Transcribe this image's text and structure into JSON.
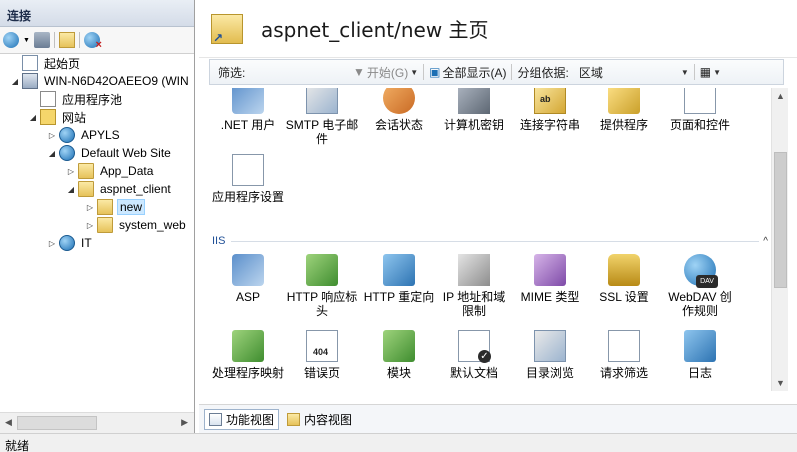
{
  "connections": {
    "title": "连接",
    "tree": [
      {
        "label": "起始页",
        "icon": "start-page-icon",
        "level": 1,
        "expander": ""
      },
      {
        "label": "WIN-N6D42OAEEO9 (WIN",
        "icon": "server-icon",
        "level": 1,
        "expander": "◢"
      },
      {
        "label": "应用程序池",
        "icon": "app-pool-icon",
        "level": 2,
        "expander": ""
      },
      {
        "label": "网站",
        "icon": "sites-icon",
        "level": 2,
        "expander": "◢"
      },
      {
        "label": "APYLS",
        "icon": "globe-icon",
        "level": 3,
        "expander": "▷"
      },
      {
        "label": "Default Web Site",
        "icon": "globe-icon",
        "level": 3,
        "expander": "◢"
      },
      {
        "label": "App_Data",
        "icon": "folder-icon",
        "level": 4,
        "expander": "▷"
      },
      {
        "label": "aspnet_client",
        "icon": "folder-icon",
        "level": 4,
        "expander": "◢"
      },
      {
        "label": "new",
        "icon": "application-icon",
        "level": 5,
        "expander": "▷",
        "selected": true
      },
      {
        "label": "system_web",
        "icon": "folder-icon",
        "level": 5,
        "expander": "▷"
      },
      {
        "label": "IT",
        "icon": "globe-icon",
        "level": 3,
        "expander": "▷"
      }
    ]
  },
  "header": {
    "title": "aspnet_client/new 主页"
  },
  "filterbar": {
    "filter_label": "筛选:",
    "start_label": "开始(G)",
    "show_all_label": "全部显示(A)",
    "groupby_label": "分组依据:",
    "groupby_value": "区域"
  },
  "features_aspnet": [
    {
      "label": ".NET 用户",
      "icon": "net-users-icon"
    },
    {
      "label": "SMTP 电子邮件",
      "icon": "smtp-email-icon"
    },
    {
      "label": "会话状态",
      "icon": "session-state-icon"
    },
    {
      "label": "计算机密钥",
      "icon": "machine-key-icon"
    },
    {
      "label": "连接字符串",
      "icon": "connection-strings-icon"
    },
    {
      "label": "提供程序",
      "icon": "providers-icon"
    },
    {
      "label": "页面和控件",
      "icon": "pages-controls-icon"
    },
    {
      "label": "应用程序设置",
      "icon": "app-settings-icon"
    }
  ],
  "iis_section": {
    "title": "IIS",
    "collapse_glyph": "^"
  },
  "features_iis": [
    {
      "label": "ASP",
      "icon": "asp-icon"
    },
    {
      "label": "HTTP 响应标头",
      "icon": "http-headers-icon"
    },
    {
      "label": "HTTP 重定向",
      "icon": "http-redirect-icon"
    },
    {
      "label": "IP 地址和域限制",
      "icon": "ip-domain-restrictions-icon"
    },
    {
      "label": "MIME 类型",
      "icon": "mime-types-icon"
    },
    {
      "label": "SSL 设置",
      "icon": "ssl-settings-icon"
    },
    {
      "label": "WebDAV 创作规则",
      "icon": "webdav-icon"
    },
    {
      "label": "处理程序映射",
      "icon": "handler-mappings-icon"
    },
    {
      "label": "错误页",
      "icon": "error-pages-icon"
    },
    {
      "label": "模块",
      "icon": "modules-icon"
    },
    {
      "label": "默认文档",
      "icon": "default-document-icon"
    },
    {
      "label": "目录浏览",
      "icon": "directory-browsing-icon"
    },
    {
      "label": "请求筛选",
      "icon": "request-filtering-icon"
    },
    {
      "label": "日志",
      "icon": "logging-icon"
    }
  ],
  "icon_badges": {
    "error_pages": "404",
    "webdav": "DAV",
    "asp_net_doc": "ab"
  },
  "tabs": {
    "features_view": "功能视图",
    "content_view": "内容视图"
  },
  "statusbar": {
    "text": "就绪"
  },
  "colors": {
    "title_bar": "#d4dce8",
    "selection": "#cce8ff",
    "section_title": "#1f4f96"
  }
}
